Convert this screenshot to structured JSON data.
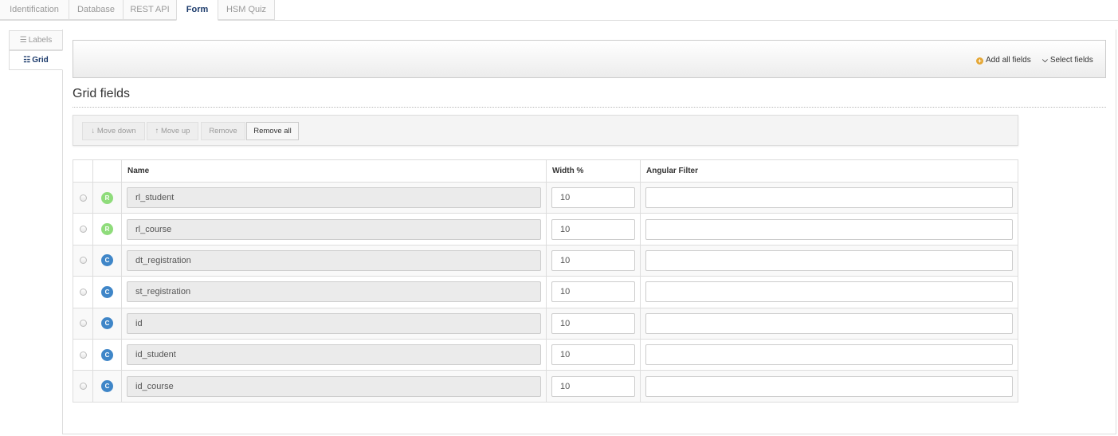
{
  "tabs": [
    {
      "label": "Identification",
      "active": false
    },
    {
      "label": "Database",
      "active": false
    },
    {
      "label": "REST API",
      "active": false
    },
    {
      "label": "Form",
      "active": true
    },
    {
      "label": "HSM Quiz",
      "active": false
    }
  ],
  "side_tabs": [
    {
      "label": "Labels",
      "icon": "list-icon",
      "active": false
    },
    {
      "label": "Grid",
      "icon": "grid-list-icon",
      "active": true
    }
  ],
  "toolbar": {
    "add_all_fields": "Add all fields",
    "select_fields": "Select fields"
  },
  "section_title": "Grid fields",
  "buttons": {
    "move_down": "Move down",
    "move_up": "Move up",
    "remove": "Remove",
    "remove_all": "Remove all"
  },
  "table": {
    "headers": [
      "",
      "",
      "Name",
      "Width %",
      "Angular Filter"
    ],
    "rows": [
      {
        "badge": "R",
        "name": "rl_student",
        "width": "10",
        "filter": ""
      },
      {
        "badge": "R",
        "name": "rl_course",
        "width": "10",
        "filter": ""
      },
      {
        "badge": "C",
        "name": "dt_registration",
        "width": "10",
        "filter": ""
      },
      {
        "badge": "C",
        "name": "st_registration",
        "width": "10",
        "filter": ""
      },
      {
        "badge": "C",
        "name": "id",
        "width": "10",
        "filter": ""
      },
      {
        "badge": "C",
        "name": "id_student",
        "width": "10",
        "filter": ""
      },
      {
        "badge": "C",
        "name": "id_course",
        "width": "10",
        "filter": ""
      }
    ]
  },
  "colors": {
    "active_tab_text": "#1b3a6b",
    "badge_relation": "#8fdc7b",
    "badge_column": "#3f86c8",
    "add_icon": "#e5a735"
  }
}
